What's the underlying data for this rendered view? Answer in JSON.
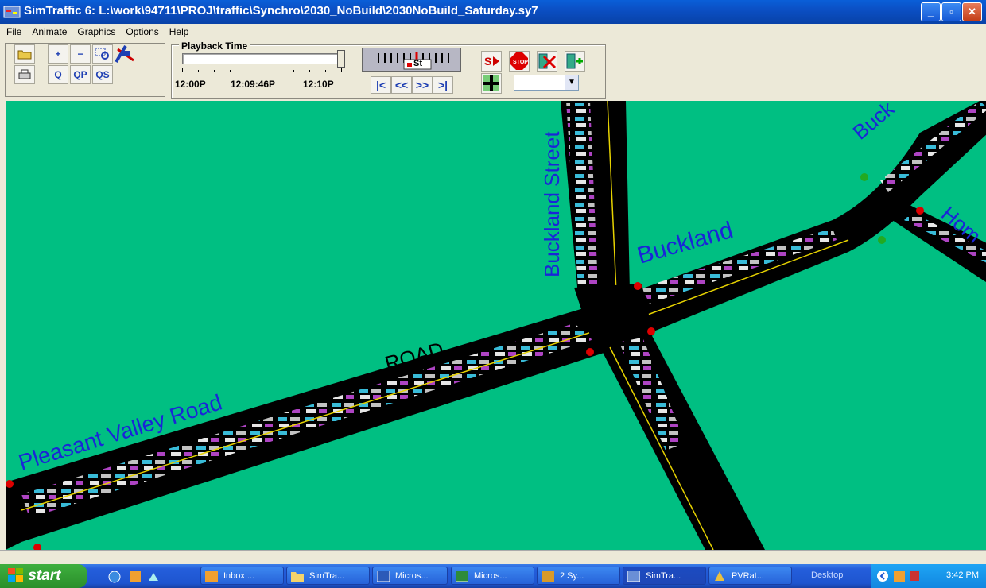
{
  "window": {
    "title": "SimTraffic 6: L:\\work\\94711\\PROJ\\traffic\\Synchro\\2030_NoBuild\\2030NoBuild_Saturday.sy7"
  },
  "menu": [
    "File",
    "Animate",
    "Graphics",
    "Options",
    "Help"
  ],
  "toolbar": {
    "zoom_in": "+",
    "zoom_out": "−",
    "zoom_all": "Q",
    "zoom_p": "QP",
    "zoom_s": "QS",
    "playback_title": "Playback Time",
    "time_start": "12:00P",
    "time_current": "12:09:46P",
    "time_end": "12:10P",
    "speed_label": "St",
    "nav": [
      "|<",
      "<<",
      ">>",
      ">|"
    ],
    "combo_value": ""
  },
  "map": {
    "streets": [
      {
        "label": "Pleasant Valley Road"
      },
      {
        "label": "ROAD"
      },
      {
        "label": "Buckland Street"
      },
      {
        "label": "Buckland"
      },
      {
        "label": "Buck"
      },
      {
        "label": "Hom"
      }
    ],
    "background_color": "#00bf82",
    "road_color": "#000000"
  },
  "taskbar": {
    "start": "start",
    "items": [
      "Inbox ...",
      "SimTra...",
      "Micros...",
      "Micros...",
      "2 Sy...",
      "SimTra...",
      "PVRat..."
    ],
    "desktop": "Desktop",
    "clock": "3:42 PM"
  }
}
